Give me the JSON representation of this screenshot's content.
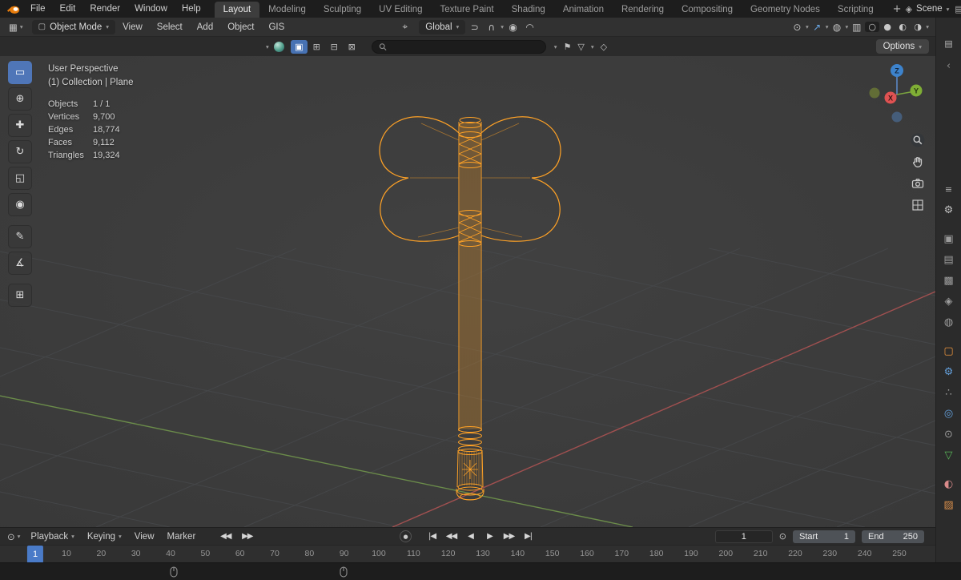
{
  "topbar": {
    "menus": [
      "File",
      "Edit",
      "Render",
      "Window",
      "Help"
    ],
    "tabs": [
      {
        "label": "Layout",
        "active": true
      },
      {
        "label": "Modeling"
      },
      {
        "label": "Sculpting"
      },
      {
        "label": "UV Editing"
      },
      {
        "label": "Texture Paint"
      },
      {
        "label": "Shading"
      },
      {
        "label": "Animation"
      },
      {
        "label": "Rendering"
      },
      {
        "label": "Compositing"
      },
      {
        "label": "Geometry Nodes"
      },
      {
        "label": "Scripting"
      }
    ],
    "add_tab": "+",
    "scene_label": "Scene"
  },
  "viewport_header": {
    "mode_label": "Object Mode",
    "menus": [
      "View",
      "Select",
      "Add",
      "Object",
      "GIS"
    ],
    "orientation_label": "Global"
  },
  "tool_settings": {
    "options_label": "Options"
  },
  "viewport": {
    "view_label": "User Perspective",
    "context_label": "(1) Collection | Plane",
    "stats": [
      {
        "label": "Objects",
        "value": "1 / 1"
      },
      {
        "label": "Vertices",
        "value": "9,700"
      },
      {
        "label": "Edges",
        "value": "18,774"
      },
      {
        "label": "Faces",
        "value": "9,112"
      },
      {
        "label": "Triangles",
        "value": "19,324"
      }
    ],
    "gizmo_axes": {
      "x": "X",
      "y": "Y",
      "z": "Z"
    }
  },
  "toolbar_tools": [
    {
      "name": "select-box-tool",
      "glyph": "▭",
      "active": true
    },
    {
      "name": "cursor-tool",
      "glyph": "⊕"
    },
    {
      "name": "move-tool",
      "glyph": "✚"
    },
    {
      "name": "rotate-tool",
      "glyph": "↻"
    },
    {
      "name": "scale-tool",
      "glyph": "◱"
    },
    {
      "name": "transform-tool",
      "glyph": "◉"
    },
    {
      "name": "annotate-tool",
      "glyph": "✎",
      "gap_before": true
    },
    {
      "name": "measure-tool",
      "glyph": "∡"
    },
    {
      "name": "add-cube-tool",
      "glyph": "⊞",
      "gap_before": true
    }
  ],
  "right_strip": {
    "tabs": [
      {
        "name": "properties-tab-tool",
        "glyph": "⚙",
        "color": "#c0c0c0"
      },
      {
        "name": "properties-tab-render",
        "glyph": "▣",
        "color": "#9c9c9c",
        "gap_before": true
      },
      {
        "name": "properties-tab-output",
        "glyph": "▤",
        "color": "#9c9c9c"
      },
      {
        "name": "properties-tab-view-layer",
        "glyph": "▩",
        "color": "#9c9c9c"
      },
      {
        "name": "properties-tab-scene",
        "glyph": "◈",
        "color": "#9c9c9c"
      },
      {
        "name": "properties-tab-world",
        "glyph": "◍",
        "color": "#9c9c9c"
      },
      {
        "name": "properties-tab-object",
        "glyph": "▢",
        "color": "#e8923d",
        "gap_before": true
      },
      {
        "name": "properties-tab-modifiers",
        "glyph": "⚙",
        "color": "#64a0dc"
      },
      {
        "name": "properties-tab-particles",
        "glyph": "∴",
        "color": "#9c9c9c"
      },
      {
        "name": "properties-tab-physics",
        "glyph": "◎",
        "color": "#64a0dc"
      },
      {
        "name": "properties-tab-constraints",
        "glyph": "⊙",
        "color": "#9c9c9c"
      },
      {
        "name": "properties-tab-object-data",
        "glyph": "▽",
        "color": "#58b658"
      },
      {
        "name": "properties-tab-material",
        "glyph": "◐",
        "color": "#d98a8a",
        "gap_before": true
      },
      {
        "name": "properties-tab-texture",
        "glyph": "▨",
        "color": "#d98f4b"
      }
    ]
  },
  "timeline": {
    "playback_label": "Playback",
    "keying_label": "Keying",
    "view_label": "View",
    "marker_label": "Marker",
    "key_jump": [
      {
        "name": "jump-prev-keyframe-button",
        "glyph": "◀◀"
      },
      {
        "name": "jump-next-keyframe-button",
        "glyph": "▶▶"
      }
    ],
    "transport": [
      {
        "name": "jump-to-start-button",
        "glyph": "|◀"
      },
      {
        "name": "prev-keyframe-button",
        "glyph": "◀◀"
      },
      {
        "name": "play-reverse-button",
        "glyph": "◀"
      },
      {
        "name": "play-button",
        "glyph": "▶"
      },
      {
        "name": "next-keyframe-button",
        "glyph": "▶▶"
      },
      {
        "name": "jump-to-end-button",
        "glyph": "▶|"
      }
    ],
    "current_frame": "1",
    "start_label": "Start",
    "start_value": "1",
    "end_label": "End",
    "end_value": "250",
    "ruler_frames": [
      10,
      20,
      30,
      40,
      50,
      60,
      70,
      80,
      90,
      100,
      110,
      120,
      130,
      140,
      150,
      160,
      170,
      180,
      190,
      200,
      210,
      220,
      230,
      240,
      250
    ]
  },
  "icons": {
    "chevron": "▾",
    "editor_3d": "▦",
    "object_mode": "▢",
    "pivot": "⌖",
    "snapping": "⊃",
    "magnet": "∩",
    "proportional": "◉",
    "falloff": "◠",
    "visibility": "⊙",
    "gizmo_nav": "↗",
    "overlays": "◍",
    "xray": "▥",
    "shade_wire": "○",
    "shade_solid": "●",
    "shade_material": "◐",
    "shade_render": "◑",
    "select_new": "▣",
    "select_extend": "⊞",
    "select_subtract": "⊟",
    "select_intersect": "⊠",
    "bookmark": "⚑",
    "funnel": "▽",
    "shield": "◇",
    "timeline_clock": "⊙",
    "autokey": "●",
    "scene": "◈",
    "view_layer": "▤",
    "outliner": "▤",
    "properties": "≡",
    "collapse_arrow": "‹"
  },
  "colors": {
    "accent_blue": "#4772b3",
    "object_orange": "#e87d0d",
    "wire_orange": "#ffa226",
    "axis_x": "#a15050",
    "axis_y": "#6b8c4a"
  }
}
